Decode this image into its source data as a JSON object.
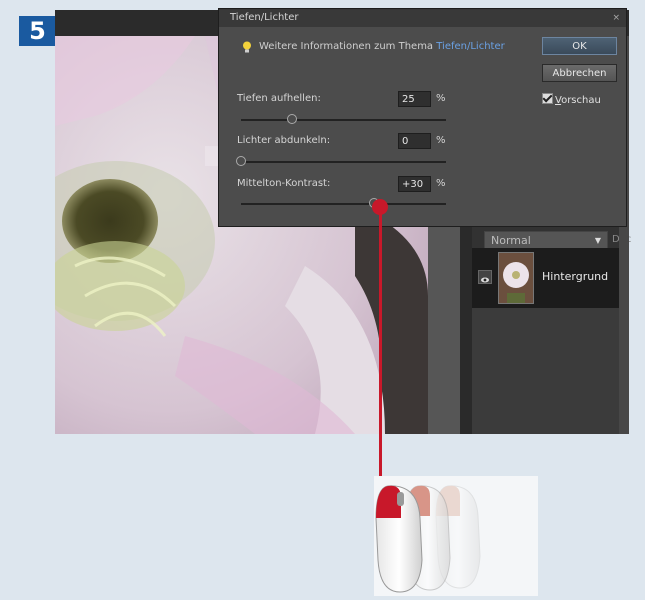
{
  "step": {
    "number": "5"
  },
  "dialog": {
    "title": "Tiefen/Lichter",
    "close_icon": "×",
    "info_text": "Weitere Informationen zum Thema",
    "info_link": "Tiefen/Lichter",
    "ok_label": "OK",
    "cancel_label": "Abbrechen",
    "preview_accel": "V",
    "preview_rest": "orschau",
    "preview_checked": true
  },
  "sliders": [
    {
      "label": "Tiefen aufhellen:",
      "value": "25",
      "unit": "%",
      "position": 0.25
    },
    {
      "label": "Lichter abdunkeln:",
      "value": "0",
      "unit": "%",
      "position": 0.0
    },
    {
      "label": "Mittelton-Kontrast:",
      "value": "+30",
      "unit": "%",
      "position": 0.65
    }
  ],
  "layers": {
    "blend_mode": "Normal",
    "opacity_label_cut": "Dec",
    "layer_name": "Hintergrund"
  },
  "colors": {
    "accent_red": "#c8182a",
    "badge_blue": "#1a5aa0",
    "link_blue": "#6aa1e4"
  }
}
